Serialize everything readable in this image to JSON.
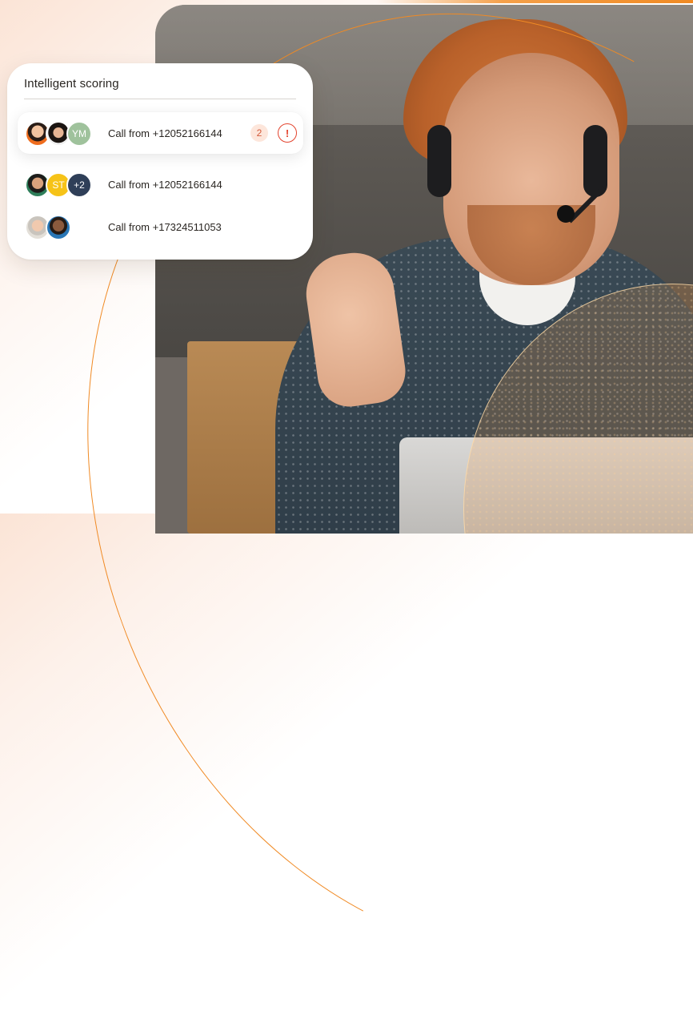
{
  "card": {
    "title": "Intelligent scoring",
    "rows": [
      {
        "label": "Call from +12052166144",
        "avatars": [
          {
            "kind": "photo",
            "name": "person-1"
          },
          {
            "kind": "photo",
            "name": "person-2"
          },
          {
            "kind": "initials",
            "text": "YM"
          }
        ],
        "badge_count": "2",
        "alert_icon": "!",
        "highlighted": true
      },
      {
        "label": "Call from +12052166144",
        "avatars": [
          {
            "kind": "photo",
            "name": "person-3"
          },
          {
            "kind": "initials",
            "text": "ST"
          },
          {
            "kind": "overflow",
            "text": "+2"
          }
        ],
        "highlighted": false
      },
      {
        "label": "Call from +17324511053",
        "avatars": [
          {
            "kind": "photo",
            "name": "person-4"
          },
          {
            "kind": "photo",
            "name": "person-5"
          }
        ],
        "highlighted": false
      }
    ]
  },
  "colors": {
    "accent": "#f08a24",
    "alert": "#e3432d",
    "badge_bg": "#fde6db",
    "avatar_ym": "#9fc29c",
    "avatar_st": "#f6c318",
    "avatar_overflow": "#2f3f58"
  },
  "photo": {
    "description_icon": "agent-with-headset-photo"
  }
}
